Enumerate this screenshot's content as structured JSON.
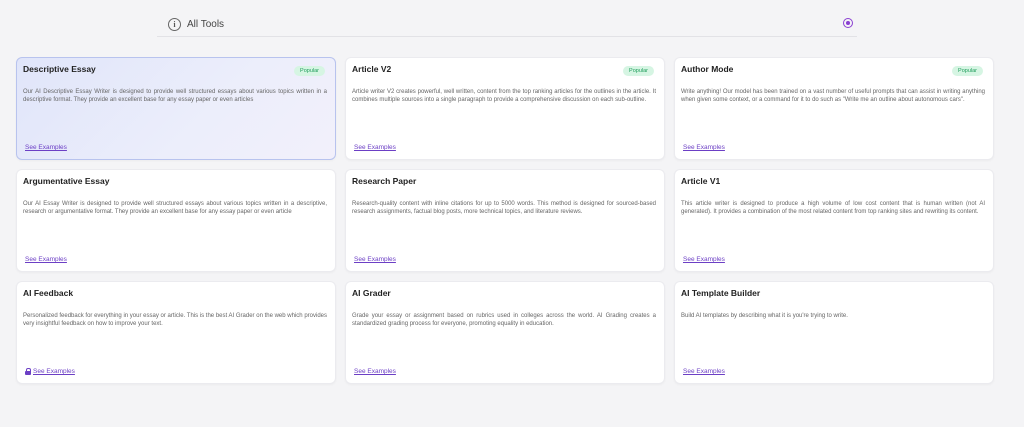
{
  "header": {
    "title": "All Tools",
    "info_icon": "info-icon",
    "close_icon": "close-circle-icon"
  },
  "colors": {
    "accent": "#6c3fc5",
    "popular_badge_bg": "#d6f5e3",
    "popular_badge_text": "#1f9d5b",
    "selected_card_bg": "#e3e8fa"
  },
  "tools": [
    {
      "title": "Descriptive Essay",
      "badge": "Popular",
      "description": "Our AI Descriptive Essay Writer is designed to provide well structured essays about various topics written in a descriptive format. They provide an excellent base for any essay paper or even articles",
      "link": "See Examples",
      "selected": true,
      "locked": false
    },
    {
      "title": "Article V2",
      "badge": "Popular",
      "description": "Article writer V2 creates powerful, well written, content from the top ranking articles for the outlines in the article. It combines multiple sources into a single paragraph to provide a comprehensive discussion on each sub-outline.",
      "link": "See Examples",
      "selected": false,
      "locked": false
    },
    {
      "title": "Author Mode",
      "badge": "Popular",
      "description": "Write anything! Our model has been trained on a vast number of useful prompts that can assist in writing anything when given some context, or a command for it to do such as \"Write me an outline about autonomous cars\".",
      "link": "See Examples",
      "selected": false,
      "locked": false
    },
    {
      "title": "Argumentative Essay",
      "badge": "",
      "description": "Our AI Essay Writer is designed to provide well structured essays about various topics written in a descriptive, research or argumentative format. They provide an excellent base for any essay paper or even article",
      "link": "See Examples",
      "selected": false,
      "locked": false
    },
    {
      "title": "Research Paper",
      "badge": "",
      "description": "Research-quality content with inline citations for up to 5000 words. This method is designed for sourced-based research assignments, factual blog posts, more technical topics, and literature reviews.",
      "link": "See Examples",
      "selected": false,
      "locked": false
    },
    {
      "title": "Article V1",
      "badge": "",
      "description": "This article writer is designed to produce a high volume of low cost content that is human written (not AI generated). It provides a combination of the most related content from top ranking sites and rewriting its content.",
      "link": "See Examples",
      "selected": false,
      "locked": false
    },
    {
      "title": "AI Feedback",
      "badge": "",
      "description": "Personalized feedback for everything in your essay or article. This is the best AI Grader on the web which provides very insightful feedback on how to improve your text.",
      "link": "See Examples",
      "selected": false,
      "locked": true
    },
    {
      "title": "AI Grader",
      "badge": "",
      "description": "Grade your essay or assignment based on rubrics used in colleges across the world. AI Grading creates a standardized grading process for everyone, promoting equality in education.",
      "link": "See Examples",
      "selected": false,
      "locked": false
    },
    {
      "title": "AI Template Builder",
      "badge": "",
      "description": "Build AI templates by describing what it is you're trying to write.",
      "link": "See Examples",
      "selected": false,
      "locked": false
    }
  ]
}
